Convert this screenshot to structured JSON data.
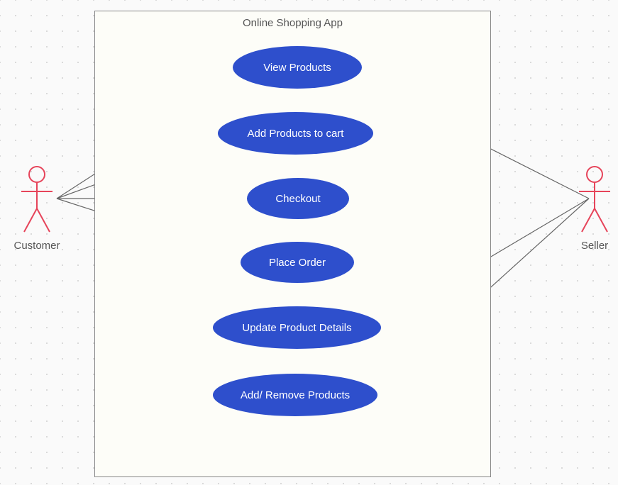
{
  "system": {
    "title": "Online Shopping App"
  },
  "actors": {
    "left": {
      "label": "Customer"
    },
    "right": {
      "label": "Seller"
    }
  },
  "usecases": {
    "uc1": {
      "label": "View Products"
    },
    "uc2": {
      "label": "Add Products to cart"
    },
    "uc3": {
      "label": "Checkout"
    },
    "uc4": {
      "label": "Place Order"
    },
    "uc5": {
      "label": "Update Product Details"
    },
    "uc6": {
      "label": "Add/ Remove Products"
    }
  }
}
